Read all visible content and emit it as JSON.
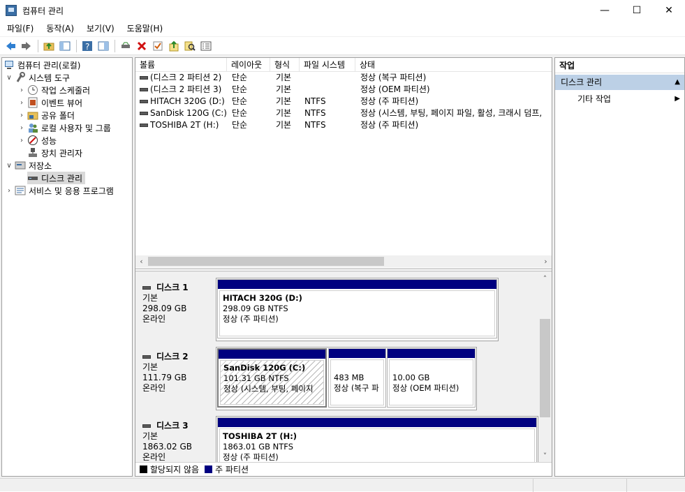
{
  "window": {
    "title": "컴퓨터 관리",
    "controls": [
      "—",
      "☐",
      "✕"
    ]
  },
  "menu": [
    "파일(F)",
    "동작(A)",
    "보기(V)",
    "도움말(H)"
  ],
  "toolbar": [
    "back-icon",
    "forward-icon",
    "up-folder-icon",
    "show-hide-tree-icon",
    "help-icon",
    "properties-pane-icon",
    "connect-icon",
    "delete-icon",
    "check-icon",
    "export-icon",
    "search-icon",
    "details-icon"
  ],
  "tree": {
    "root": "컴퓨터 관리(로컬)",
    "system_tools": "시스템 도구",
    "task_scheduler": "작업 스케줄러",
    "event_viewer": "이벤트 뷰어",
    "shared_folders": "공유 폴더",
    "local_users": "로컬 사용자 및 그룹",
    "performance": "성능",
    "device_manager": "장치 관리자",
    "storage": "저장소",
    "disk_management": "디스크 관리",
    "services": "서비스 및 응용 프로그램"
  },
  "volume_list": {
    "headers": [
      "볼륨",
      "레이아웃",
      "형식",
      "파일 시스템",
      "상태"
    ],
    "rows": [
      {
        "volume": "(디스크 2 파티션 2)",
        "layout": "단순",
        "type": "기본",
        "fs": "",
        "status": "정상 (복구 파티션)"
      },
      {
        "volume": "(디스크 2 파티션 3)",
        "layout": "단순",
        "type": "기본",
        "fs": "",
        "status": "정상 (OEM 파티션)"
      },
      {
        "volume": "HITACH 320G (D:)",
        "layout": "단순",
        "type": "기본",
        "fs": "NTFS",
        "status": "정상 (주 파티션)"
      },
      {
        "volume": "SanDisk 120G (C:)",
        "layout": "단순",
        "type": "기본",
        "fs": "NTFS",
        "status": "정상 (시스템, 부팅, 페이지 파일, 활성, 크래시 덤프,"
      },
      {
        "volume": "TOSHIBA 2T (H:)",
        "layout": "단순",
        "type": "기본",
        "fs": "NTFS",
        "status": "정상 (주 파티션)"
      }
    ]
  },
  "disks": [
    {
      "name": "디스크 1",
      "type": "기본",
      "size": "298.09 GB",
      "state": "온라인",
      "partitions": [
        {
          "name": "HITACH 320G  (D:)",
          "size": "298.09 GB NTFS",
          "status": "정상 (주 파티션)"
        }
      ]
    },
    {
      "name": "디스크 2",
      "type": "기본",
      "size": "111.79 GB",
      "state": "온라인",
      "partitions": [
        {
          "name": "SanDisk 120G  (C:)",
          "size": "101.31 GB NTFS",
          "status": "정상 (시스템, 부팅, 페이지"
        },
        {
          "name": "",
          "size": "483 MB",
          "status": "정상 (복구 파"
        },
        {
          "name": "",
          "size": "10.00 GB",
          "status": "정상 (OEM 파티션)"
        }
      ]
    },
    {
      "name": "디스크 3",
      "type": "기본",
      "size": "1863.02 GB",
      "state": "온라인",
      "partitions": [
        {
          "name": "TOSHIBA 2T  (H:)",
          "size": "1863.01 GB NTFS",
          "status": "정상 (주 파티션)"
        }
      ]
    }
  ],
  "legend": {
    "unallocated": "할당되지 않음",
    "primary": "주 파티션",
    "unallocated_color": "#000000",
    "primary_color": "#000080"
  },
  "actions": {
    "header": "작업",
    "section": "디스크 관리",
    "more": "기타 작업"
  }
}
